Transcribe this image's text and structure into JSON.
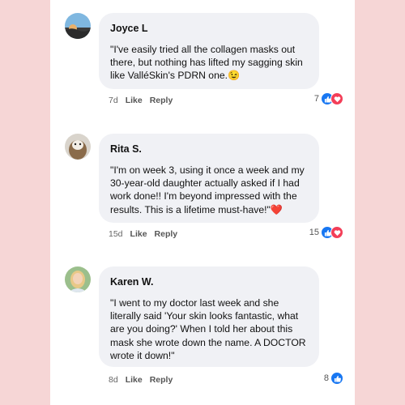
{
  "comments": [
    {
      "name": "Joyce L",
      "text": "\"I've easily tried all the collagen masks out there, but nothing has lifted my sagging skin like ValléSkin's PDRN one.",
      "emoji": "😉",
      "time": "7d",
      "like_label": "Like",
      "reply_label": "Reply",
      "reaction_count": "7",
      "reactions": [
        "like-icon",
        "love-icon"
      ]
    },
    {
      "name": "Rita S.",
      "text": "\"I'm on week 3, using it once a week and my 30-year-old daughter actually asked if I had work done!! I'm beyond impressed with the results. This is a lifetime must-have!\"",
      "emoji": "❤️",
      "time": "15d",
      "like_label": "Like",
      "reply_label": "Reply",
      "reaction_count": "15",
      "reactions": [
        "like-icon",
        "love-icon"
      ]
    },
    {
      "name": "Karen W.",
      "text": "\"I went to my doctor last week and she literally said 'Your skin looks fantastic, what are you doing?' When I told her about this mask she wrote down the name. A DOCTOR wrote it down!\"",
      "emoji": "",
      "time": "8d",
      "like_label": "Like",
      "reply_label": "Reply",
      "reaction_count": "8",
      "reactions": [
        "like-icon"
      ]
    }
  ],
  "colors": {
    "background": "#f6d6d6",
    "bubble": "#f0f1f5",
    "like": "#1877f2",
    "love": "#f33e58"
  }
}
